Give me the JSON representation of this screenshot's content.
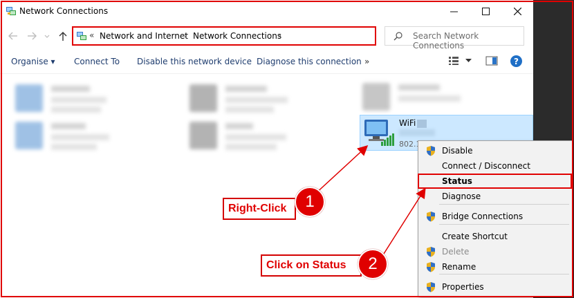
{
  "window": {
    "title": "Network Connections"
  },
  "address": {
    "overflow": "«",
    "crumbs": [
      "Network and Internet",
      "Network Connections"
    ],
    "separator": "›",
    "search_placeholder": "Search Network Connections"
  },
  "commands": {
    "organise": "Organise ▾",
    "connect_to": "Connect To",
    "disable": "Disable this network device",
    "diagnose": "Diagnose this connection",
    "more": "»",
    "help": "?"
  },
  "wifi": {
    "name": "WiFi",
    "type": "802.1"
  },
  "menu": {
    "items": [
      {
        "label": "Disable",
        "shield": true,
        "enabled": true,
        "bold": false
      },
      {
        "label": "Connect / Disconnect",
        "shield": false,
        "enabled": true,
        "bold": false
      },
      {
        "label": "Status",
        "shield": false,
        "enabled": true,
        "bold": true
      },
      {
        "label": "Diagnose",
        "shield": false,
        "enabled": true,
        "bold": false
      },
      {
        "label": "Bridge Connections",
        "shield": true,
        "enabled": true,
        "bold": false
      },
      {
        "label": "Create Shortcut",
        "shield": false,
        "enabled": true,
        "bold": false
      },
      {
        "label": "Delete",
        "shield": true,
        "enabled": false,
        "bold": false
      },
      {
        "label": "Rename",
        "shield": true,
        "enabled": true,
        "bold": false
      },
      {
        "label": "Properties",
        "shield": true,
        "enabled": true,
        "bold": false
      }
    ]
  },
  "annotations": {
    "step1_text": "Right-Click",
    "step1_num": "1",
    "step2_text": "Click on Status",
    "step2_num": "2"
  },
  "colors": {
    "highlight": "#e00000",
    "selection": "#cce8ff",
    "link": "#1e3c6e"
  }
}
